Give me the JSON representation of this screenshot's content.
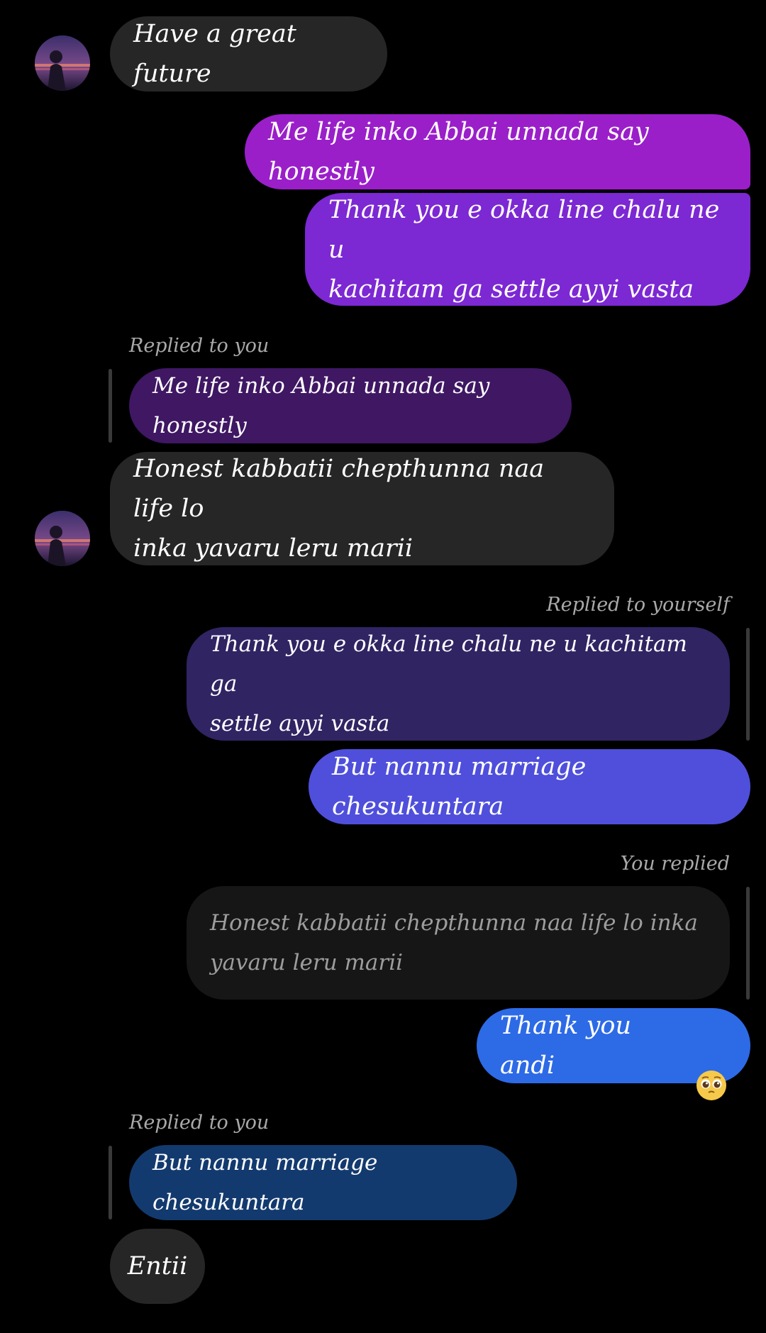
{
  "colors": {
    "background": "#000000",
    "incoming_bubble": "#262626",
    "outgoing_purple": "#9a1fc9",
    "outgoing_violet": "#7c28d3",
    "outgoing_indigo": "#4f4fdc",
    "outgoing_blue": "#2d6ae6",
    "reply_quote_purple": "#3f1763",
    "reply_quote_indigo": "#302463",
    "reply_quote_dark": "#161616",
    "reply_quote_navy": "#133a6e",
    "meta_text": "#a9a9a9"
  },
  "messages": [
    {
      "type": "incoming",
      "text": "Have a great future",
      "avatar": "contact-avatar"
    },
    {
      "type": "outgoing",
      "text": "Me life inko Abbai unnada say honestly"
    },
    {
      "type": "outgoing",
      "text": "Thank you e okka line chalu ne u\nkachitam ga settle ayyi vasta"
    },
    {
      "type": "incoming_reply",
      "reply_label": "Replied to you",
      "quoted_text": "Me life inko Abbai unnada say honestly",
      "text": "Honest kabbatii chepthunna naa life lo\ninka yavaru leru marii",
      "avatar": "contact-avatar"
    },
    {
      "type": "outgoing_reply",
      "reply_label": "Replied to yourself",
      "quoted_text": "Thank you e okka line chalu ne u kachitam ga\nsettle ayyi vasta",
      "text": "But nannu marriage chesukuntara"
    },
    {
      "type": "outgoing_reply",
      "reply_label": "You replied",
      "quoted_text": "Honest kabbatii chepthunna naa life lo inka\nyavaru leru marii",
      "text": "Thank you andi",
      "emoji": "🥺"
    },
    {
      "type": "incoming_reply",
      "reply_label": "Replied to you",
      "quoted_text": "But nannu marriage chesukuntara",
      "text": "Entii"
    }
  ]
}
